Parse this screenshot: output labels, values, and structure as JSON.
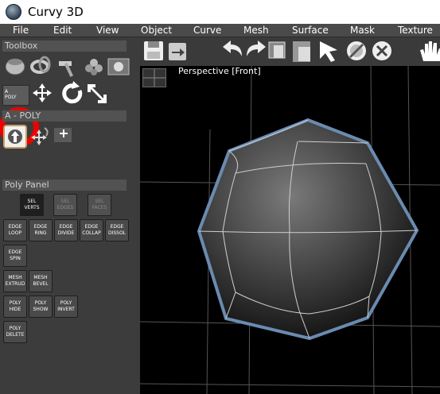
{
  "app": {
    "title": "Curvy 3D",
    "icon": "curvy-app-icon"
  },
  "menu": [
    "File",
    "Edit",
    "View",
    "Object",
    "Curve",
    "Mesh",
    "Surface",
    "Mask",
    "Texture"
  ],
  "toolbox": {
    "header": "Toolbox",
    "apoly_button": "A\nPOLY",
    "apoly_header": "A - POLY"
  },
  "poly_panel": {
    "header": "Poly Panel",
    "buttons": [
      "SEL\nVERTS",
      "SEL\nEDGES",
      "SEL\nFACES",
      "EDGE\nLOOP",
      "EDGE\nRING",
      "EDGE\nDIVIDE",
      "EDGE\nCOLLAP",
      "EDGE\nDISSOL",
      "EDGE\nSPIN",
      "MESH\nEXTRUD",
      "MESH\nBEVEL",
      "POLY\nHIDE",
      "POLY\nSHOW",
      "POLY\nINVERT",
      "POLY\nDELETE"
    ]
  },
  "viewport": {
    "label": "Perspective [Front]"
  },
  "colors": {
    "menubar": "#4a4a4a",
    "highlight_ring": "#ee0000",
    "mesh_outline": "#6a8bb0"
  }
}
